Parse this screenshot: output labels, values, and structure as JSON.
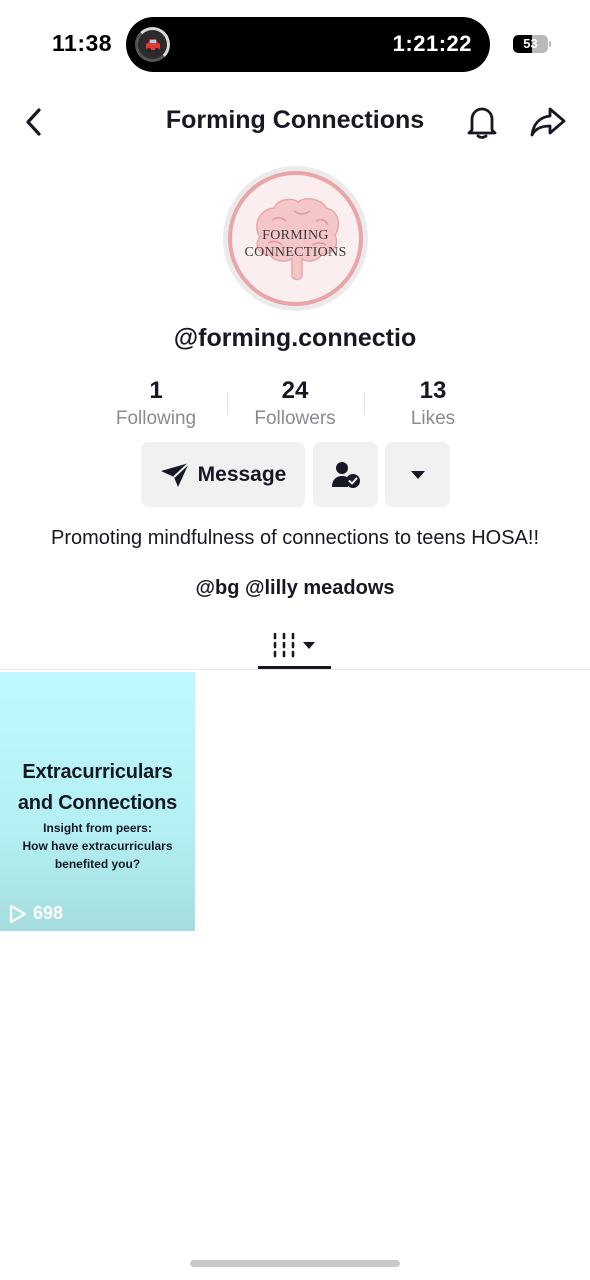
{
  "status_bar": {
    "time": "11:38",
    "activity_timer": "1:21:22",
    "activity_app_icon": "car-icon",
    "battery_level": "53",
    "battery_fraction": 0.53
  },
  "header": {
    "title": "Forming Connections",
    "back_icon": "chevron-left-icon",
    "bell_icon": "bell-icon",
    "share_icon": "share-arrow-icon"
  },
  "profile": {
    "avatar_line1": "FORMING",
    "avatar_line2": "CONNECTIONS",
    "username": "@forming.connectio",
    "stats": {
      "following_count": "1",
      "following_label": "Following",
      "followers_count": "24",
      "followers_label": "Followers",
      "likes_count": "13",
      "likes_label": "Likes"
    },
    "actions": {
      "message_label": "Message",
      "message_icon": "send-icon",
      "follow_icon": "user-check-icon",
      "more_icon": "caret-down-icon"
    },
    "bio": "Promoting mindfulness of connections to teens HOSA!!",
    "bio_links": "@bg @lilly meadows"
  },
  "tabs": {
    "active_icon": "grid-columns-icon"
  },
  "videos": [
    {
      "title_line1": "Extracurriculars",
      "title_line2": "and Connections",
      "sub_line1": "Insight from peers:",
      "sub_line2": "How have extracurriculars",
      "sub_line3": "benefited you?",
      "views": "698"
    }
  ],
  "colors": {
    "text_primary": "#161823",
    "text_secondary": "#8a8b91",
    "button_bg": "#f1f1f2",
    "avatar_ring": "#eaa5a8",
    "tile_bg": "#bff9fd"
  }
}
